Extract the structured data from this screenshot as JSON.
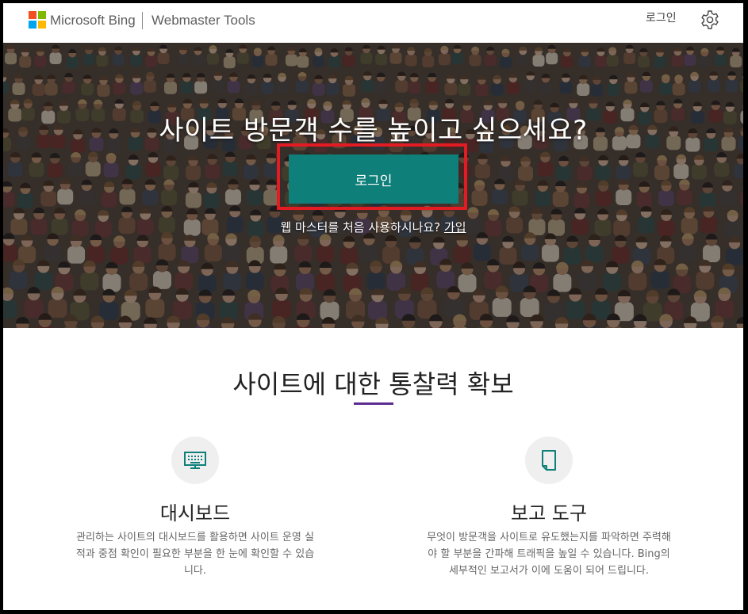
{
  "header": {
    "brand": "Microsoft Bing",
    "product": "Webmaster Tools",
    "login_label": "로그인",
    "logo_colors": [
      "#f25022",
      "#7fba00",
      "#00a4ef",
      "#ffb900"
    ]
  },
  "hero": {
    "title": "사이트 방문객 수를 높이고 싶으세요?",
    "login_button": "로그인",
    "signup_prompt": "웹 마스터를 처음 사용하시나요?",
    "signup_link": "가입",
    "button_color": "#0f7f7a",
    "highlight_color": "#e31b23"
  },
  "section": {
    "title": "사이트에 대한 통찰력 확보",
    "accent_color": "#5c2d91",
    "features": [
      {
        "icon": "dashboard-monitor-icon",
        "title": "대시보드",
        "description": "관리하는 사이트의 대시보드를 활용하면 사이트 운영 실적과 중점 확인이 필요한 부분을 한 눈에 확인할 수 있습니다."
      },
      {
        "icon": "report-document-icon",
        "title": "보고 도구",
        "description": "무엇이 방문객을 사이트로 유도했는지를 파악하면 주력해야 할 부분을 간파해 트래픽을 높일 수 있습니다. Bing의 세부적인 보고서가 이에 도움이 되어 드립니다."
      }
    ]
  }
}
